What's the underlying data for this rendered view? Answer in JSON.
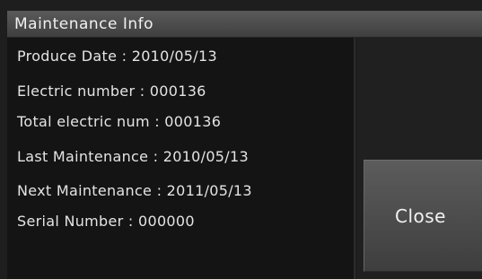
{
  "dialog": {
    "title": "Maintenance Info",
    "close_label": "Close"
  },
  "info": {
    "produce_date": "Produce Date : 2010/05/13",
    "electric_number": "Electric number  : 000136",
    "total_electric_num": "Total electric num : 000136",
    "last_maintenance": "Last Maintenance : 2010/05/13",
    "next_maintenance": "Next Maintenance : 2011/05/13",
    "serial_number": "Serial Number : 000000"
  }
}
